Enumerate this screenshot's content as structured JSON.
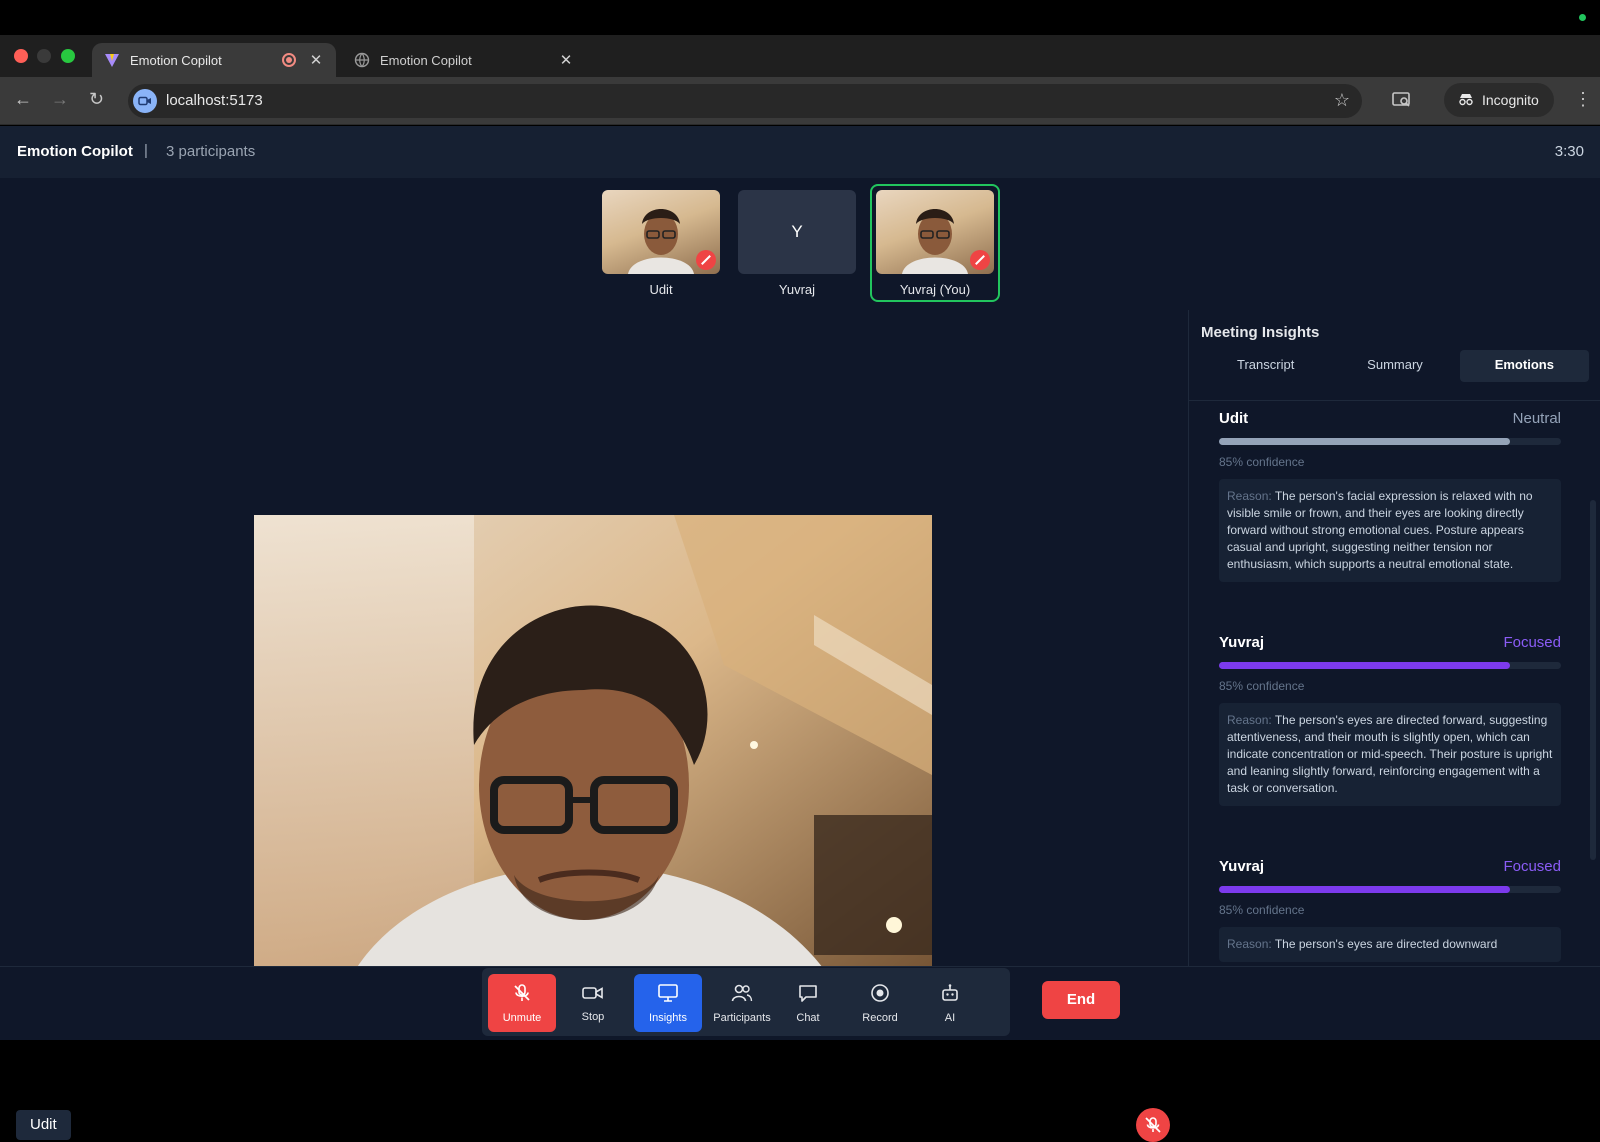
{
  "browser": {
    "tabs": [
      {
        "title": "Emotion Copilot",
        "active": true
      },
      {
        "title": "Emotion Copilot",
        "active": false
      }
    ],
    "url": "localhost:5173",
    "incognito_label": "Incognito"
  },
  "app": {
    "title": "Emotion Copilot",
    "separator": "|",
    "participant_count": "3 participants",
    "timer": "3:30"
  },
  "participants": [
    {
      "name": "Udit",
      "avatar_initial": "",
      "muted": true,
      "you": false
    },
    {
      "name": "Yuvraj",
      "avatar_initial": "Y",
      "muted": false,
      "you": false
    },
    {
      "name": "Yuvraj (You)",
      "avatar_initial": "",
      "muted": true,
      "you": true
    }
  ],
  "stage": {
    "speaker_name": "Udit"
  },
  "insights": {
    "title": "Meeting Insights",
    "tabs": [
      "Transcript",
      "Summary",
      "Emotions"
    ],
    "active_tab": "Emotions",
    "reason_label": "Reason:",
    "cards": [
      {
        "name": "Udit",
        "emotion": "Neutral",
        "emotion_color": "#94a3b8",
        "bar_color": "#94a3b8",
        "confidence": 0.85,
        "confidence_text": "85% confidence",
        "reason": "The person's facial expression is relaxed with no visible smile or frown, and their eyes are looking directly forward without strong emotional cues. Posture appears casual and upright, suggesting neither tension nor enthusiasm, which supports a neutral emotional state."
      },
      {
        "name": "Yuvraj",
        "emotion": "Focused",
        "emotion_color": "#8b5cf6",
        "bar_color": "#7c3aed",
        "confidence": 0.85,
        "confidence_text": "85% confidence",
        "reason": "The person's eyes are directed forward, suggesting attentiveness, and their mouth is slightly open, which can indicate concentration or mid-speech. Their posture is upright and leaning slightly forward, reinforcing engagement with a task or conversation."
      },
      {
        "name": "Yuvraj",
        "emotion": "Focused",
        "emotion_color": "#8b5cf6",
        "bar_color": "#7c3aed",
        "confidence": 0.85,
        "confidence_text": "85% confidence",
        "reason": "The person's eyes are directed downward"
      }
    ]
  },
  "controls": {
    "unmute": "Unmute",
    "stop": "Stop",
    "insights": "Insights",
    "participants": "Participants",
    "chat": "Chat",
    "record": "Record",
    "ai": "AI",
    "end": "End"
  },
  "colors": {
    "app_bg": "#0f1729",
    "danger": "#ef4444",
    "primary": "#2563eb",
    "active_ring": "#22c55e"
  }
}
